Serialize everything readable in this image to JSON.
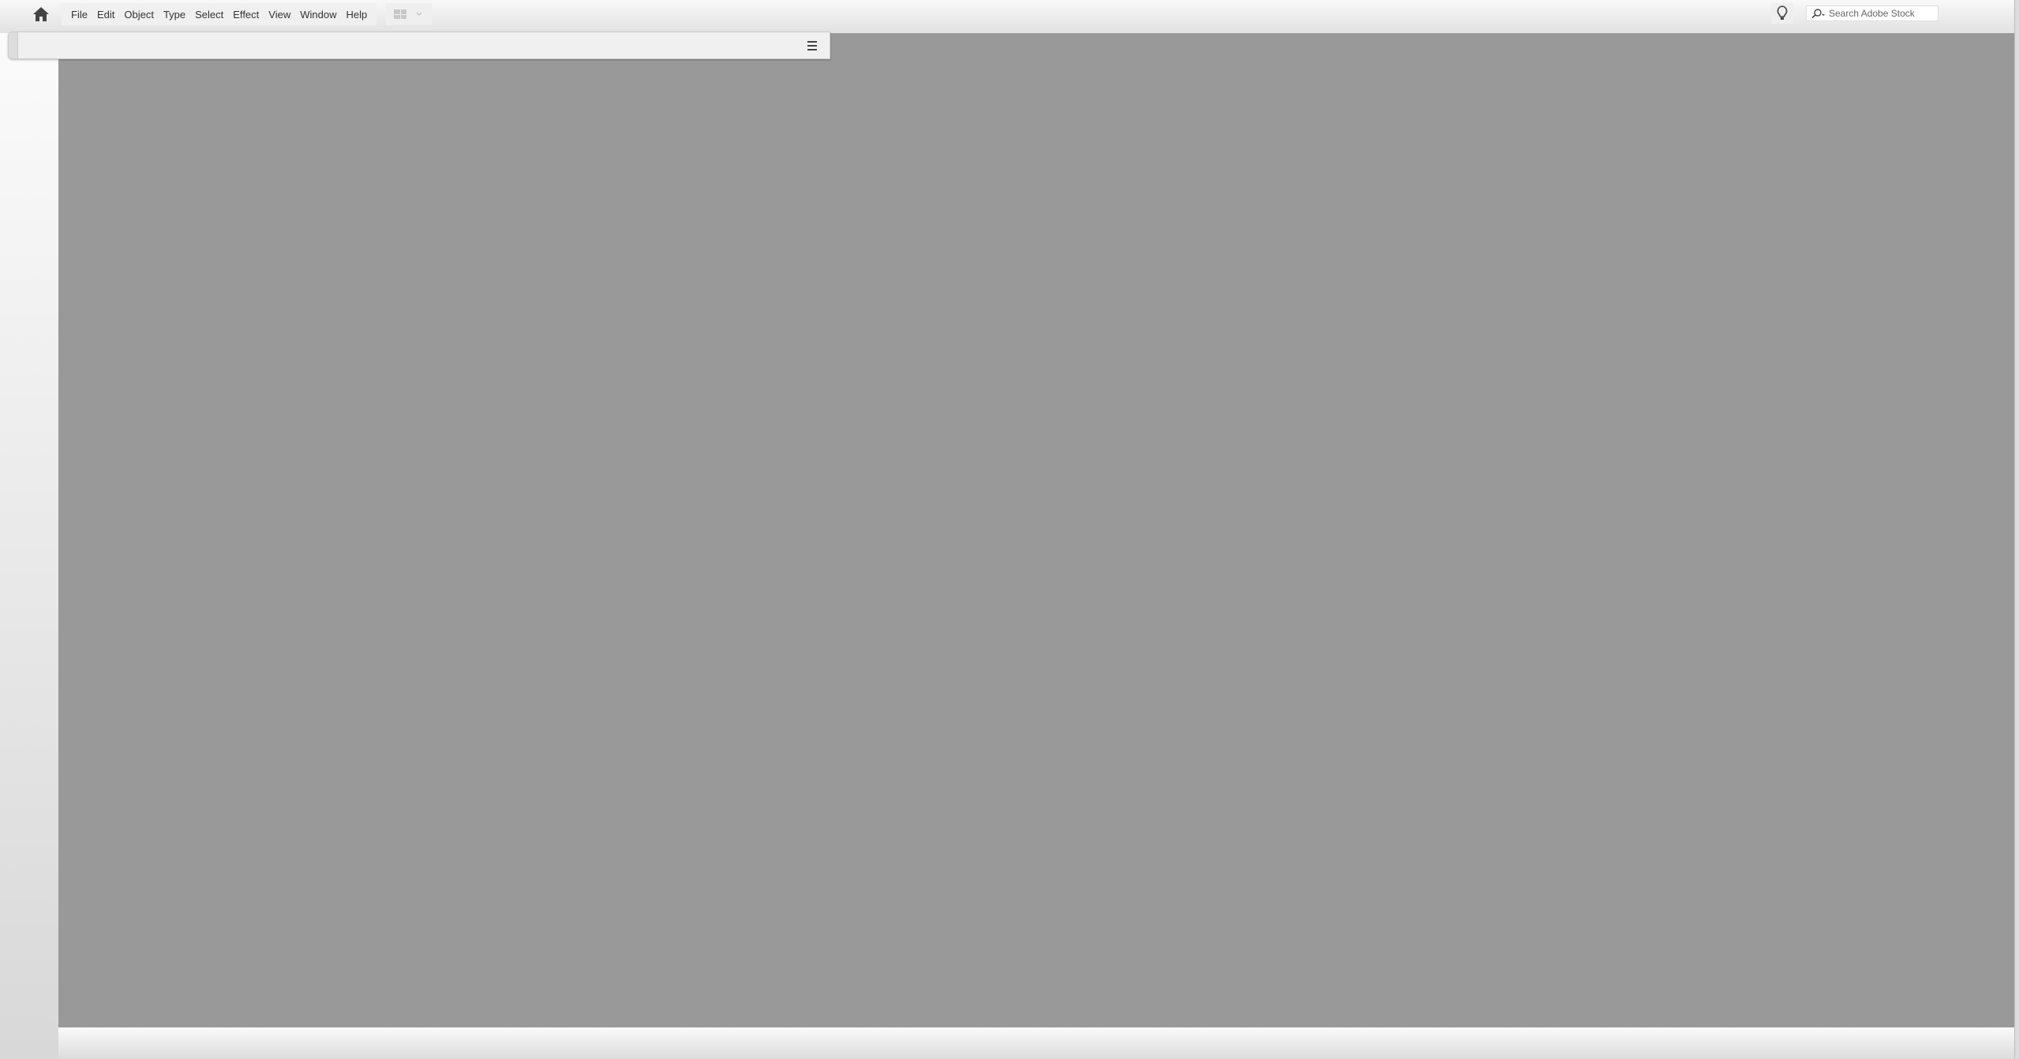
{
  "menubar": {
    "items": [
      "File",
      "Edit",
      "Object",
      "Type",
      "Select",
      "Effect",
      "View",
      "Window",
      "Help"
    ],
    "search_placeholder": "Search Adobe Stock"
  },
  "icons": {
    "home": "home-icon",
    "workspace": "workspace-switcher-icon",
    "bulb": "lightbulb-icon",
    "search": "search-icon",
    "panel_menu": "panel-menu-icon"
  },
  "colors": {
    "canvas": "#999999",
    "chrome": "#f0f0f0"
  }
}
